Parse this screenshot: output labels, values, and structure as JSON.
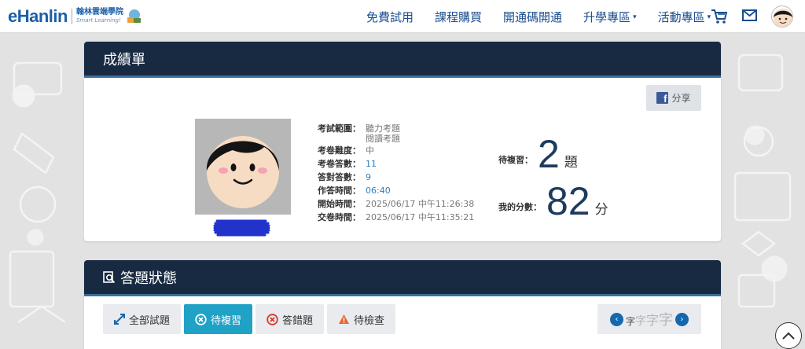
{
  "brand": {
    "logo_text": "eHanlin",
    "logo_sub_cn": "翰林雲端學院",
    "logo_sub_en": "Smart Learning!"
  },
  "nav": {
    "items": [
      {
        "label": "免費試用",
        "dropdown": false
      },
      {
        "label": "課程購買",
        "dropdown": false
      },
      {
        "label": "開通碼開通",
        "dropdown": false
      },
      {
        "label": "升學專區",
        "dropdown": true
      },
      {
        "label": "活動專區",
        "dropdown": true
      }
    ],
    "caret": "▾",
    "icons": [
      "cart-icon",
      "mail-icon",
      "user-avatar"
    ]
  },
  "report": {
    "title": "成績單",
    "share_label": "分享",
    "share_icon": "facebook-icon",
    "info": [
      {
        "label": "考試範圍：",
        "value": [
          "聽力考題",
          "閱讀考題"
        ],
        "style": "gray"
      },
      {
        "label": "考卷難度：",
        "value": "中",
        "style": "gray"
      },
      {
        "label": "考卷答數：",
        "value": "11",
        "style": "blue"
      },
      {
        "label": "答對答數：",
        "value": "9",
        "style": "blue"
      },
      {
        "label": "作答時間：",
        "value": "06:40",
        "style": "blue"
      },
      {
        "label": "開始時間：",
        "value": "2025/06/17 中午11:26:38",
        "style": "gray"
      },
      {
        "label": "交卷時間：",
        "value": "2025/06/17 中午11:35:21",
        "style": "gray"
      }
    ],
    "review": {
      "label": "待複習：",
      "value": "2",
      "unit": "題"
    },
    "score": {
      "label": "我的分數：",
      "value": "82",
      "unit": "分"
    }
  },
  "answers": {
    "title": "答題狀態",
    "title_icon": "search-doc-icon",
    "tabs": [
      {
        "label": "全部試題",
        "icon": "expand-icon",
        "active": false
      },
      {
        "label": "待複習",
        "icon": "circle-x-icon",
        "active": true
      },
      {
        "label": "答錯題",
        "icon": "red-x-icon",
        "active": false
      },
      {
        "label": "待檢查",
        "icon": "warning-icon",
        "active": false
      }
    ],
    "font_size_control": {
      "chars": [
        "字",
        "字",
        "字",
        "字"
      ],
      "prev": "‹",
      "next": "›"
    }
  },
  "colors": {
    "header_dark": "#182a41",
    "nav_blue": "#1a4d8f",
    "active_tab": "#20a1c6",
    "score_num": "#1e3b5e"
  }
}
